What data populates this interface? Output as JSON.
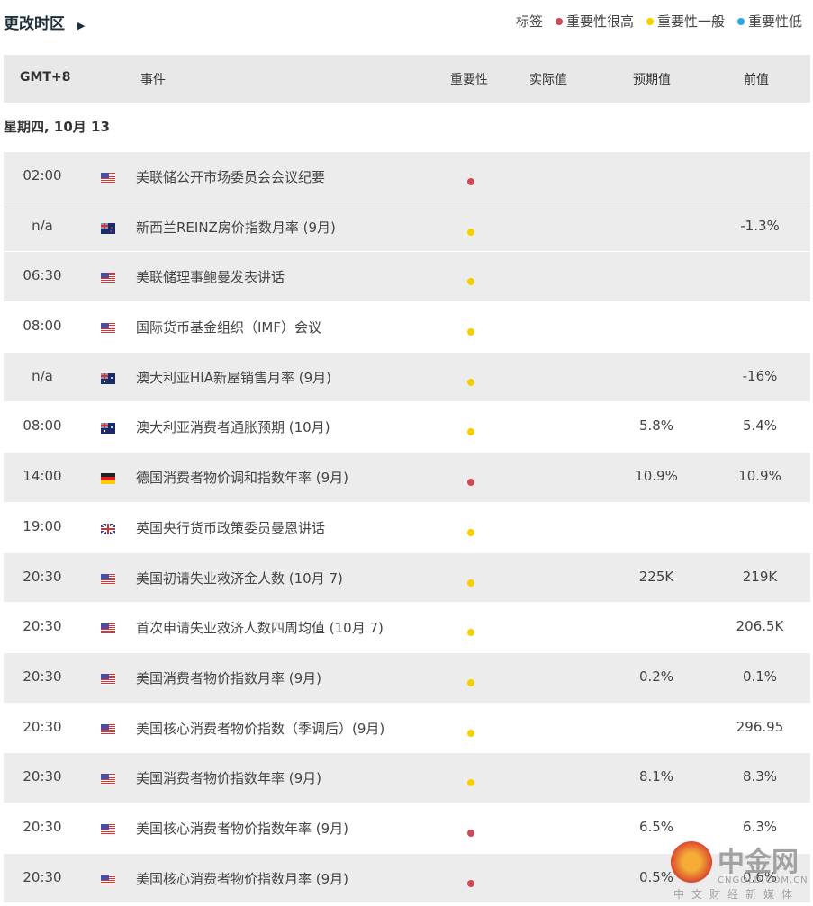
{
  "header": {
    "timezone_label": "更改时区",
    "arrow": "▶",
    "legend_label": "标签",
    "legend": [
      {
        "label": "重要性很高",
        "color": "#cc4b57"
      },
      {
        "label": "重要性一般",
        "color": "#f5d000"
      },
      {
        "label": "重要性低",
        "color": "#2aa5e8"
      }
    ]
  },
  "table": {
    "columns": [
      "GMT+8",
      "事件",
      "重要性",
      "实际值",
      "预期值",
      "前值"
    ],
    "date": "星期四, 10月 13",
    "rows": [
      {
        "time": "02:00",
        "country": "us",
        "event": "美联储公开市场委员会会议纪要",
        "importance": "high",
        "actual": "",
        "forecast": "",
        "previous": ""
      },
      {
        "time": "n/a",
        "country": "nz",
        "event": "新西兰REINZ房价指数月率 (9月)",
        "importance": "medium",
        "actual": "",
        "forecast": "",
        "previous": "-1.3%"
      },
      {
        "time": "06:30",
        "country": "us",
        "event": "美联储理事鲍曼发表讲话",
        "importance": "medium",
        "actual": "",
        "forecast": "",
        "previous": ""
      },
      {
        "time": "08:00",
        "country": "us",
        "event": "国际货币基金组织（IMF）会议",
        "importance": "medium",
        "actual": "",
        "forecast": "",
        "previous": ""
      },
      {
        "time": "n/a",
        "country": "au",
        "event": "澳大利亚HIA新屋销售月率 (9月)",
        "importance": "medium",
        "actual": "",
        "forecast": "",
        "previous": "-16%"
      },
      {
        "time": "08:00",
        "country": "au",
        "event": "澳大利亚消费者通胀预期 (10月)",
        "importance": "medium",
        "actual": "",
        "forecast": "5.8%",
        "previous": "5.4%"
      },
      {
        "time": "14:00",
        "country": "de",
        "event": "德国消费者物价调和指数年率 (9月)",
        "importance": "high",
        "actual": "",
        "forecast": "10.9%",
        "previous": "10.9%"
      },
      {
        "time": "19:00",
        "country": "gb",
        "event": "英国央行货币政策委员曼恩讲话",
        "importance": "medium",
        "actual": "",
        "forecast": "",
        "previous": ""
      },
      {
        "time": "20:30",
        "country": "us",
        "event": "美国初请失业救济金人数 (10月 7)",
        "importance": "medium",
        "actual": "",
        "forecast": "225K",
        "previous": "219K"
      },
      {
        "time": "20:30",
        "country": "us",
        "event": "首次申请失业救济人数四周均值 (10月 7)",
        "importance": "medium",
        "actual": "",
        "forecast": "",
        "previous": "206.5K"
      },
      {
        "time": "20:30",
        "country": "us",
        "event": "美国消费者物价指数月率 (9月)",
        "importance": "medium",
        "actual": "",
        "forecast": "0.2%",
        "previous": "0.1%"
      },
      {
        "time": "20:30",
        "country": "us",
        "event": "美国核心消费者物价指数（季调后）(9月)",
        "importance": "medium",
        "actual": "",
        "forecast": "",
        "previous": "296.95"
      },
      {
        "time": "20:30",
        "country": "us",
        "event": "美国消费者物价指数年率 (9月)",
        "importance": "medium",
        "actual": "",
        "forecast": "8.1%",
        "previous": "8.3%"
      },
      {
        "time": "20:30",
        "country": "us",
        "event": "美国核心消费者物价指数年率 (9月)",
        "importance": "high",
        "actual": "",
        "forecast": "6.5%",
        "previous": "6.3%"
      },
      {
        "time": "20:30",
        "country": "us",
        "event": "美国核心消费者物价指数月率 (9月)",
        "importance": "high",
        "actual": "",
        "forecast": "0.5%",
        "previous": "0.6%"
      }
    ]
  },
  "colors": {
    "high": "#cc4b57",
    "medium": "#f5d000",
    "low": "#2aa5e8"
  },
  "watermark": {
    "name": "中金网",
    "domain": "CNGOLD.COM.CN",
    "tagline": "中文财经新媒体"
  }
}
